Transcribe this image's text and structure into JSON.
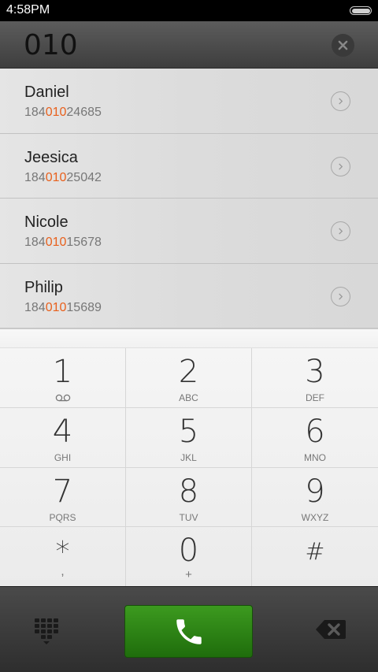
{
  "status_bar": {
    "time": "4:58PM",
    "battery_level": 1.0
  },
  "dialer": {
    "dialed_number": "010",
    "clear_icon": "close-icon"
  },
  "results": [
    {
      "name": "Daniel",
      "number_prefix": "184",
      "number_match": "010",
      "number_suffix": "24685"
    },
    {
      "name": "Jeesica",
      "number_prefix": "184",
      "number_match": "010",
      "number_suffix": "25042"
    },
    {
      "name": "Nicole",
      "number_prefix": "184",
      "number_match": "010",
      "number_suffix": "15678"
    },
    {
      "name": "Philip",
      "number_prefix": "184",
      "number_match": "010",
      "number_suffix": "15689"
    }
  ],
  "keypad": {
    "keys": [
      {
        "digit": "1",
        "letters": "",
        "icon": "voicemail-icon"
      },
      {
        "digit": "2",
        "letters": "ABC"
      },
      {
        "digit": "3",
        "letters": "DEF"
      },
      {
        "digit": "4",
        "letters": "GHI"
      },
      {
        "digit": "5",
        "letters": "JKL"
      },
      {
        "digit": "6",
        "letters": "MNO"
      },
      {
        "digit": "7",
        "letters": "PQRS"
      },
      {
        "digit": "8",
        "letters": "TUV"
      },
      {
        "digit": "9",
        "letters": "WXYZ"
      },
      {
        "digit": "*",
        "letters": ","
      },
      {
        "digit": "0",
        "letters": "+"
      },
      {
        "digit": "#",
        "letters": ""
      }
    ]
  },
  "bottom_bar": {
    "dialpad_icon": "dialpad-grid-icon",
    "call_icon": "phone-icon",
    "call_color": "#2e8a17",
    "backspace_icon": "backspace-icon"
  },
  "colors": {
    "match_highlight": "#e8601c"
  }
}
